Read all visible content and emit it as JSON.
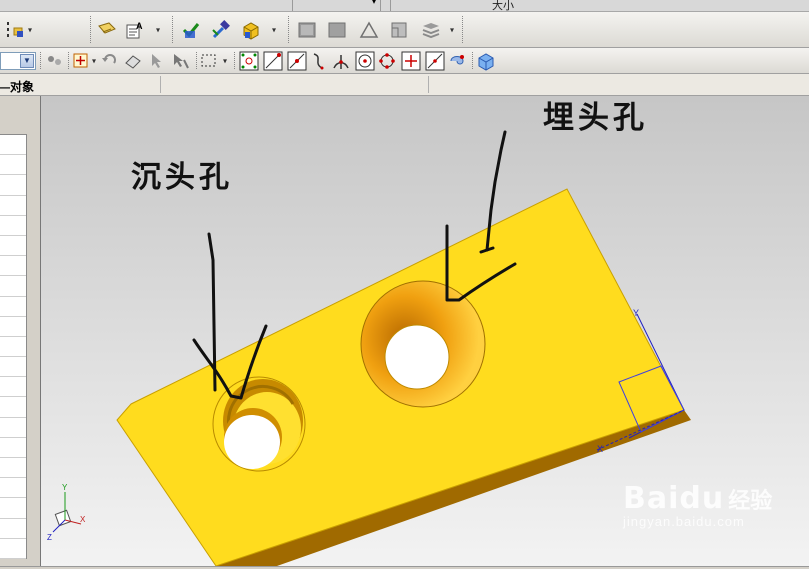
{
  "header": {
    "size_label": "大小"
  },
  "toolbar1": {
    "icons": [
      "layer-icon",
      "note-icon",
      "text-style-icon",
      "check-blue-icon",
      "hammer-icon",
      "cube-yellow-icon",
      "shaded-view-icon",
      "shaded-view-2-icon",
      "triangle-icon",
      "hidden-line-icon",
      "layers-stack-icon"
    ]
  },
  "toolbar2": {
    "icons": [
      "select-filter-icon",
      "snap-point-icon",
      "undo-icon",
      "eraser-icon",
      "pointer-icon",
      "select-box-icon",
      "end-point-icon",
      "mid-point-icon",
      "line-point-icon",
      "curve-icon",
      "intersection-icon",
      "arc-center-icon",
      "quadrant-icon",
      "cross-icon",
      "tangent-icon",
      "pole-icon",
      "view-cube-icon"
    ]
  },
  "selection": {
    "label": "—对象"
  },
  "viewport": {
    "annotations": {
      "counterbore": "沉头孔",
      "countersink": "埋头孔"
    },
    "part_color": "#ffdc1e",
    "watermark": {
      "logo": "Baidu",
      "brand": "经验",
      "url": "jingyan.baidu.com"
    }
  }
}
